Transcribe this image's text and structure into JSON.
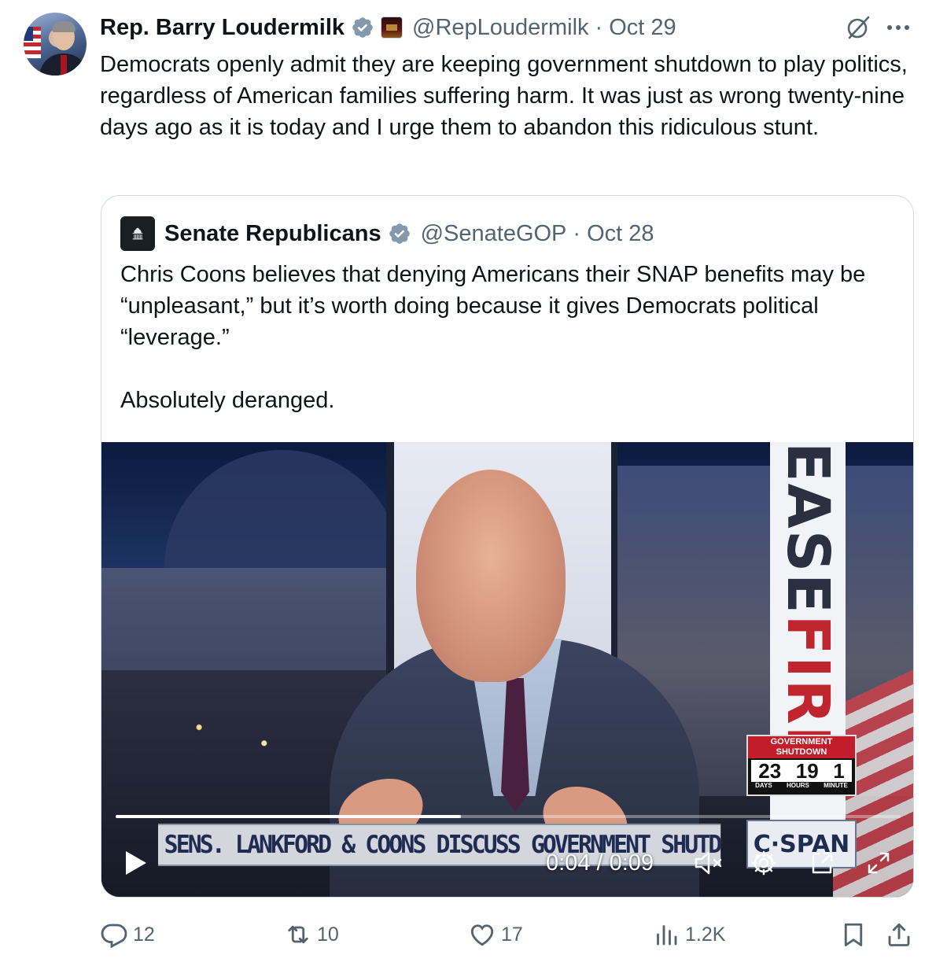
{
  "tweet": {
    "author_name": "Rep. Barry Loudermilk",
    "handle": "@RepLoudermilk",
    "separator": "·",
    "date": "Oct 29",
    "text": "Democrats openly admit they are keeping government shutdown to play politics, regardless of American families suffering harm. It was just as wrong twenty-nine days ago as it is today and I urge them to abandon this ridiculous stunt."
  },
  "quoted": {
    "author_name": "Senate Republicans",
    "handle": "@SenateGOP",
    "separator": "·",
    "date": "Oct 28",
    "text": "Chris Coons believes that denying Americans their SNAP benefits may be “unpleasant,” but it’s worth doing because it gives Democrats political “leverage.”\n\nAbsolutely deranged."
  },
  "video": {
    "current_time": "0:04",
    "duration": "0:09",
    "time_display": "0:04 / 0:09",
    "progress_fraction": 0.44,
    "caption": "SENS. LANKFORD & COONS DISCUSS GOVERNMENT SHUTDOWN",
    "network_logo": "C·SPAN",
    "vertical_banner_a": "EASE",
    "vertical_banner_b": "FIRE",
    "shutdown_box": {
      "title_line1": "GOVERNMENT",
      "title_line2": "SHUTDOWN",
      "days": "23",
      "hours": "19",
      "minute": "1",
      "days_label": "DAYS",
      "hours_label": "HOURS",
      "minute_label": "MINUTE"
    }
  },
  "actions": {
    "reply_count": "12",
    "retweet_count": "10",
    "like_count": "17",
    "views_count": "1.2K"
  },
  "colors": {
    "text_primary": "#0f1419",
    "text_secondary": "#536471",
    "verified_blue": "#829aab",
    "border": "#cfd9de"
  },
  "icons": [
    "verified-icon",
    "grok-icon",
    "more-icon",
    "play-icon",
    "mute-icon",
    "settings-icon",
    "pip-icon",
    "fullscreen-icon",
    "reply-icon",
    "retweet-icon",
    "like-icon",
    "views-icon",
    "bookmark-icon",
    "share-icon",
    "capitol-icon"
  ]
}
